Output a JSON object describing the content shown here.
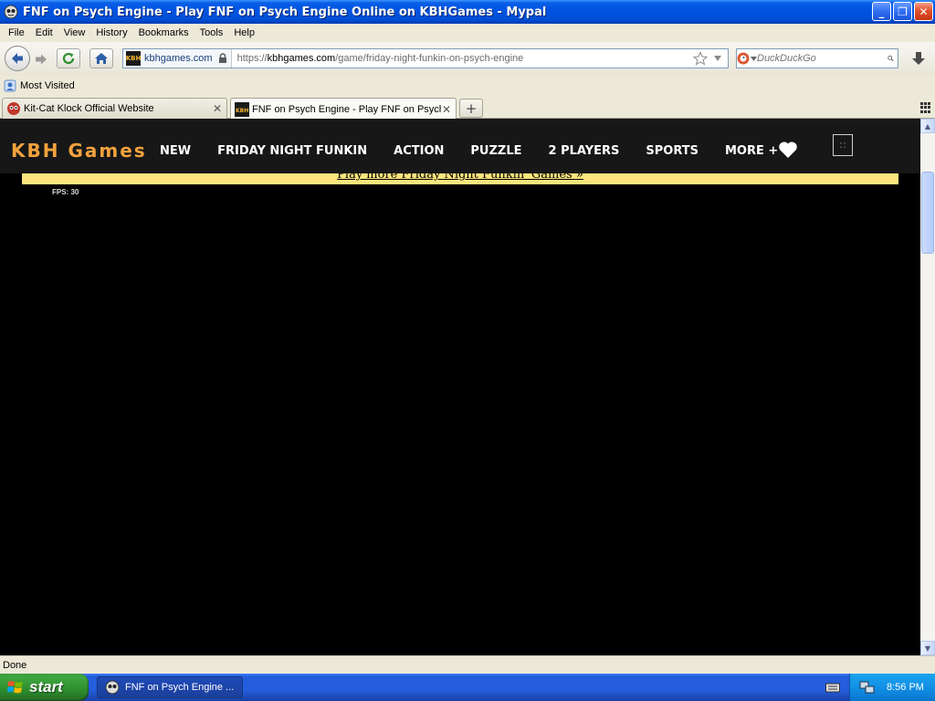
{
  "window": {
    "title": "FNF on Psych Engine - Play FNF on Psych Engine Online on KBHGames - Mypal",
    "minimize": "_",
    "maximize": "❐",
    "close": "✕"
  },
  "menu": {
    "file": "File",
    "edit": "Edit",
    "view": "View",
    "history": "History",
    "bookmarks": "Bookmarks",
    "tools": "Tools",
    "help": "Help"
  },
  "navbar": {
    "site_name": "kbhgames.com",
    "site_favicon_text": "KBH",
    "url_scheme": "https://",
    "url_host": "kbhgames.com",
    "url_path": "/game/friday-night-funkin-on-psych-engine",
    "search_placeholder": "DuckDuckGo"
  },
  "bookmarks_bar": {
    "most_visited": "Most Visited"
  },
  "tabs": [
    {
      "label": "Kit-Cat Klock Official Website",
      "active": false
    },
    {
      "label": "FNF on Psych Engine - Play FNF on Psych...",
      "active": true
    }
  ],
  "site": {
    "logo": "KBH Games",
    "nav": [
      "NEW",
      "FRIDAY NIGHT FUNKIN",
      "ACTION",
      "PUZZLE",
      "2 PLAYERS",
      "SPORTS",
      "MORE +"
    ],
    "banner_link": "Play more Friday Night Funkin' Games »",
    "fps": "FPS: 30",
    "accent_color": "#f2a23d",
    "banner_color": "#fbe57c"
  },
  "statusbar": {
    "text": "Done"
  },
  "taskbar": {
    "start": "start",
    "task_label": "FNF on Psych Engine ...",
    "clock": "8:56 PM"
  }
}
